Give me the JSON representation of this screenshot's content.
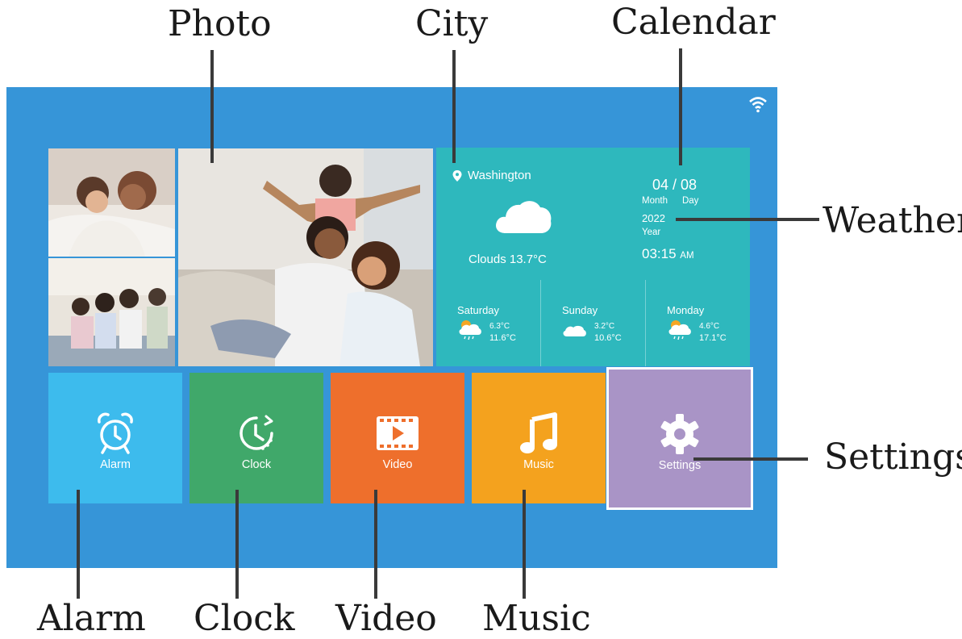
{
  "callouts": {
    "photo": "Photo",
    "city": "City",
    "calendar": "Calendar",
    "weather": "Weather",
    "settings": "Settings",
    "alarm": "Alarm",
    "clock": "Clock",
    "video": "Video",
    "music": "Music"
  },
  "weather": {
    "city": "Washington",
    "condition": "Clouds 13.7°C",
    "icon": "cloud-icon"
  },
  "calendar": {
    "date": "04 / 08",
    "month_label": "Month",
    "day_label": "Day",
    "year": "2022",
    "year_label": "Year",
    "time": "03:15",
    "ampm": "AM"
  },
  "forecast": [
    {
      "day": "Saturday",
      "low": "6.3°C",
      "high": "11.6°C",
      "icon": "sun-cloud-rain-icon"
    },
    {
      "day": "Sunday",
      "low": "3.2°C",
      "high": "10.6°C",
      "icon": "cloud-icon"
    },
    {
      "day": "Monday",
      "low": "4.6°C",
      "high": "17.1°C",
      "icon": "sun-cloud-rain-icon"
    }
  ],
  "tiles": [
    {
      "label": "Alarm",
      "color": "#3dbbed",
      "icon": "alarm-clock-icon"
    },
    {
      "label": "Clock",
      "color": "#40a86a",
      "icon": "clock-icon"
    },
    {
      "label": "Video",
      "color": "#ee6f2c",
      "icon": "video-icon"
    },
    {
      "label": "Music",
      "color": "#f4a21e",
      "icon": "music-note-icon"
    },
    {
      "label": "Settings",
      "color": "#a994c6",
      "icon": "gear-icon"
    }
  ],
  "colors": {
    "screen_bg": "#3695d8",
    "weather_bg": "#2eb8bd"
  }
}
